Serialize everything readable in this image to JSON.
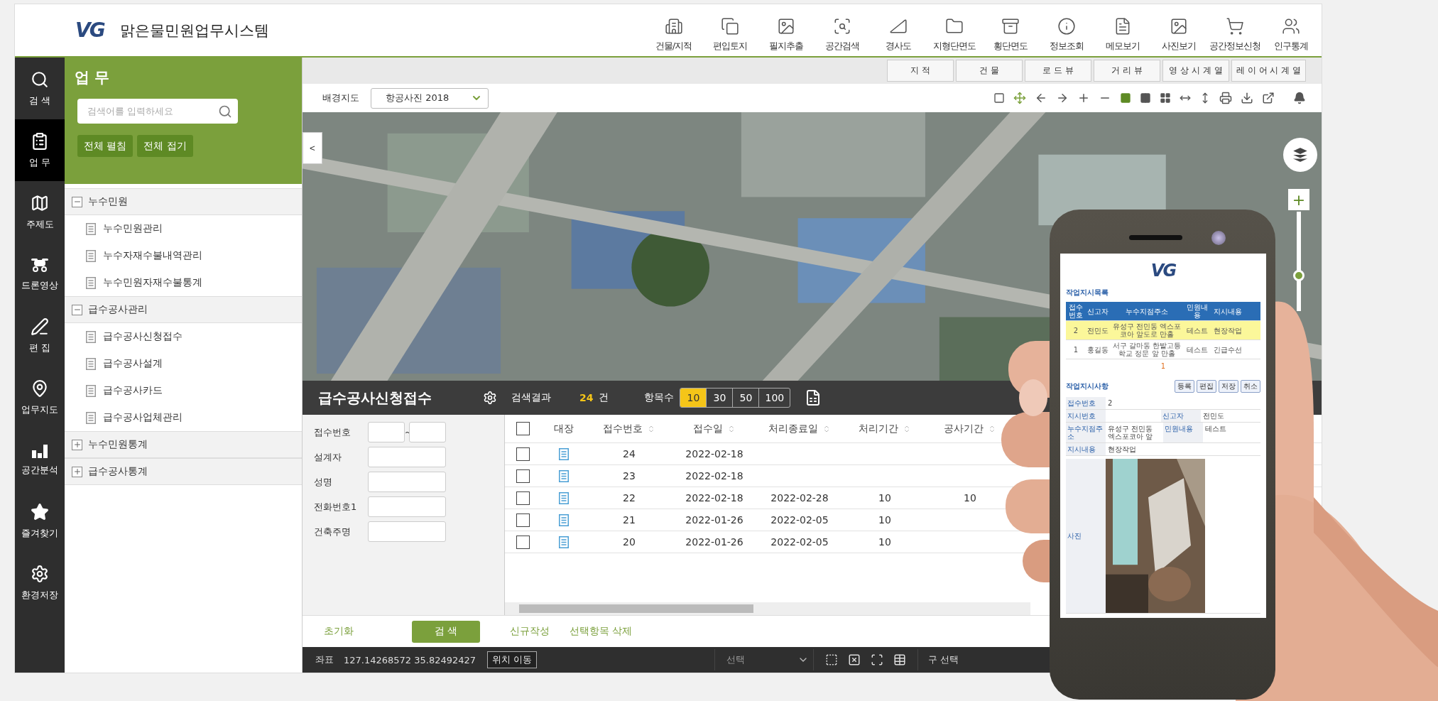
{
  "header": {
    "logo": "VG",
    "title": "맑은물민원업무시스템",
    "menu": [
      {
        "label": "건물/지적"
      },
      {
        "label": "편입토지"
      },
      {
        "label": "필지추출"
      },
      {
        "label": "공간검색"
      },
      {
        "label": "경사도"
      },
      {
        "label": "지형단면도"
      },
      {
        "label": "횡단면도"
      },
      {
        "label": "정보조회"
      },
      {
        "label": "메모보기"
      },
      {
        "label": "사진보기"
      },
      {
        "label": "공간정보신청"
      },
      {
        "label": "인구통계"
      }
    ]
  },
  "nav": [
    {
      "label": "검 색",
      "selected": false
    },
    {
      "label": "업 무",
      "selected": true
    },
    {
      "label": "주제도",
      "selected": false
    },
    {
      "label": "드론영상",
      "selected": false
    },
    {
      "label": "편 집",
      "selected": false
    },
    {
      "label": "업무지도",
      "selected": false
    },
    {
      "label": "공간분석",
      "selected": false
    },
    {
      "label": "즐겨찾기",
      "selected": false
    },
    {
      "label": "환경저장",
      "selected": false
    }
  ],
  "panel": {
    "title": "업 무",
    "search": {
      "placeholder": "검색어를 입력하세요"
    },
    "buttons": [
      "전체 펼침",
      "전체 접기"
    ],
    "tree": [
      {
        "label": "누수민원",
        "expanded": true,
        "children": [
          {
            "label": "누수민원관리"
          },
          {
            "label": "누수자재수불내역관리"
          },
          {
            "label": "누수민원자재수불통계"
          }
        ]
      },
      {
        "label": "급수공사관리",
        "expanded": true,
        "children": [
          {
            "label": "급수공사신청접수"
          },
          {
            "label": "급수공사설계"
          },
          {
            "label": "급수공사카드"
          },
          {
            "label": "급수공사업체관리"
          }
        ]
      },
      {
        "label": "누수민원통계",
        "expanded": false
      },
      {
        "label": "급수공사통계",
        "expanded": false
      }
    ]
  },
  "map_tabs": [
    "지 적",
    "건 물",
    "로 드 뷰",
    "거 리 뷰",
    "영 상 시 계 열",
    "레 이 어 시 계 열"
  ],
  "toolbar": {
    "basemap_label": "배경지도",
    "basemap_value": "항공사진 2018",
    "layouts": [
      {
        "selected": true
      },
      {
        "selected": false
      },
      {
        "selected": false
      },
      {
        "selected": false
      },
      {
        "selected": false
      }
    ]
  },
  "map": {
    "zoom_in": "+",
    "zoom_slider": {
      "level": 0.36
    },
    "collapse": "<"
  },
  "bottom": {
    "title": "급수공사신청접수",
    "result_label": "검색결과",
    "result_count": "24",
    "result_unit": "건",
    "page_size_label": "항목수",
    "page_sizes": [
      {
        "label": "10",
        "selected": true
      },
      {
        "label": "30",
        "selected": false
      },
      {
        "label": "50",
        "selected": false
      },
      {
        "label": "100",
        "selected": false
      }
    ],
    "form": [
      {
        "label": "접수번호",
        "kind": "range",
        "separator": "~"
      },
      {
        "label": "설계자",
        "kind": "text"
      },
      {
        "label": "성명",
        "kind": "text"
      },
      {
        "label": "전화번호1",
        "kind": "text"
      },
      {
        "label": "건축주명",
        "kind": "text"
      }
    ],
    "table": {
      "columns": [
        "대장",
        "접수번호",
        "접수일",
        "처리종료일",
        "처리기간",
        "공사기간"
      ],
      "all_checked": false,
      "rows": [
        {
          "checked": false,
          "cells": [
            "",
            "24",
            "2022-02-18",
            "",
            "",
            ""
          ]
        },
        {
          "checked": false,
          "cells": [
            "",
            "23",
            "2022-02-18",
            "",
            "",
            ""
          ]
        },
        {
          "checked": false,
          "cells": [
            "",
            "22",
            "2022-02-18",
            "2022-02-28",
            "10",
            "10"
          ]
        },
        {
          "checked": false,
          "cells": [
            "",
            "21",
            "2022-01-26",
            "2022-02-05",
            "10",
            ""
          ]
        },
        {
          "checked": false,
          "cells": [
            "",
            "20",
            "2022-01-26",
            "2022-02-05",
            "10",
            ""
          ]
        }
      ]
    },
    "reset": "초기화",
    "search": "검 색",
    "actions": [
      "신규작성",
      "선택항목 삭제"
    ]
  },
  "status": {
    "coord_label": "좌표",
    "coords": "127.14268572 35.82492427",
    "move": "위치 이동",
    "select": "선택",
    "district": "구 선택"
  },
  "phone": {
    "logo": "VG",
    "list_title": "작업지시목록",
    "columns": [
      "접수번호",
      "신고자",
      "누수지점주소",
      "민원내용",
      "지시내용"
    ],
    "rows": [
      {
        "selected": true,
        "cells": [
          "2",
          "전민도",
          "유성구 전민동 엑스포코아 앞도로 만홀",
          "테스트",
          "현장작업"
        ]
      },
      {
        "selected": false,
        "cells": [
          "1",
          "홍길동",
          "서구 갈마동 한밭고등학교 정문 앞 만홀",
          "테스트",
          "긴급수선"
        ]
      }
    ],
    "pager": "1",
    "detail_title": "작업지시사항",
    "buttons": [
      "등록",
      "편집",
      "저장",
      "취소"
    ],
    "fields": [
      [
        {
          "label": "접수번호",
          "value": "2"
        }
      ],
      [
        {
          "label": "지시번호"
        },
        {
          "label": "신고자",
          "value": "전민도"
        }
      ],
      [
        {
          "label": "누수지점주소",
          "value": "유성구 전민동 엑스포코아 앞"
        },
        {
          "label": "민원내용",
          "value": "테스트"
        }
      ],
      [
        {
          "label": "지시내용",
          "value": "현장작업"
        }
      ]
    ],
    "photo_label": "사진"
  }
}
